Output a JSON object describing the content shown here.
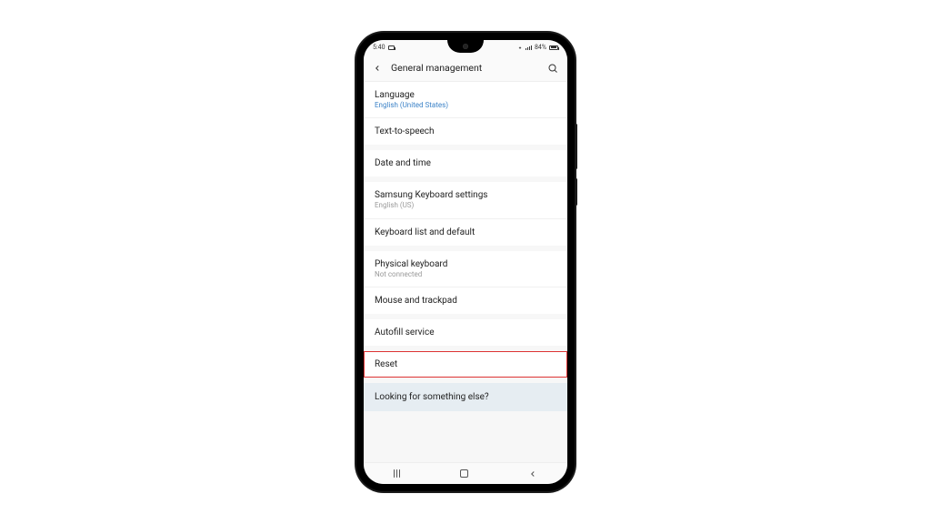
{
  "statusbar": {
    "time": "5:40",
    "battery_pct": "84%"
  },
  "header": {
    "title": "General management"
  },
  "groups": [
    {
      "items": [
        {
          "label": "Language",
          "sub": "English (United States)",
          "subStyle": "blue"
        },
        {
          "label": "Text-to-speech"
        }
      ]
    },
    {
      "items": [
        {
          "label": "Date and time"
        }
      ]
    },
    {
      "items": [
        {
          "label": "Samsung Keyboard settings",
          "sub": "English (US)",
          "subStyle": "gray"
        },
        {
          "label": "Keyboard list and default"
        }
      ]
    },
    {
      "items": [
        {
          "label": "Physical keyboard",
          "sub": "Not connected",
          "subStyle": "gray"
        },
        {
          "label": "Mouse and trackpad"
        }
      ]
    },
    {
      "items": [
        {
          "label": "Autofill service"
        }
      ]
    },
    {
      "items": [
        {
          "label": "Reset",
          "highlight": true
        }
      ]
    }
  ],
  "footer_prompt": "Looking for something else?"
}
